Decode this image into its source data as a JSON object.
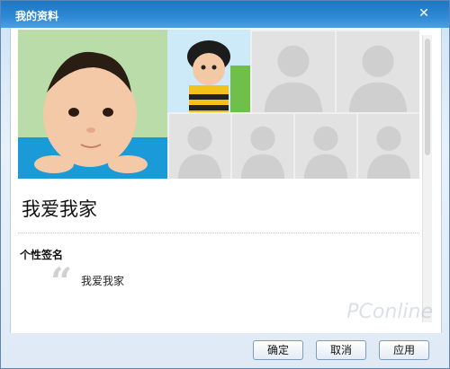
{
  "window": {
    "title": "我的资料",
    "close_label": "✕"
  },
  "profile": {
    "nickname": "我爱我家",
    "signature_section_label": "个性签名",
    "signature_text": "我爱我家",
    "quote_glyph": "“"
  },
  "buttons": {
    "ok": "确定",
    "cancel": "取消",
    "apply": "应用"
  },
  "watermark": "PConline",
  "icons": {
    "close": "close-icon",
    "placeholder": "person-placeholder-icon",
    "quote": "quote-icon"
  },
  "colors": {
    "titlebar": "#2e8ad6",
    "placeholder_bg": "#e2e2e2",
    "placeholder_figure": "#cfcfcf"
  }
}
